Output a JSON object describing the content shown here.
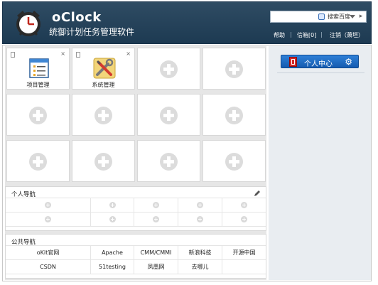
{
  "app": {
    "title": "oClock",
    "subtitle": "统御计划任务管理软件"
  },
  "header": {
    "search": {
      "value": "",
      "placeholder": "",
      "engine_label": "搜索百度"
    },
    "links": {
      "help": "帮助",
      "messages": "信箱[0]",
      "logout": "注销（萧垣）"
    }
  },
  "tiles": [
    {
      "label": "项目管理",
      "icon": "project-window-icon"
    },
    {
      "label": "系统管理",
      "icon": "tools-icon"
    }
  ],
  "personal_nav": {
    "title": "个人导航"
  },
  "public_nav": {
    "title": "公共导航",
    "links": [
      "oKit官网",
      "Apache",
      "CMM/CMMI",
      "新浪科技",
      "开源中国",
      "CSDN",
      "51testing",
      "凤凰网",
      "去哪儿",
      ""
    ]
  },
  "right_panel": {
    "profile_label": "个人中心"
  },
  "colors": {
    "header_bg": "#1d3a52",
    "accent_blue": "#1f6cc4",
    "panel_bg": "#e6e6e6"
  }
}
